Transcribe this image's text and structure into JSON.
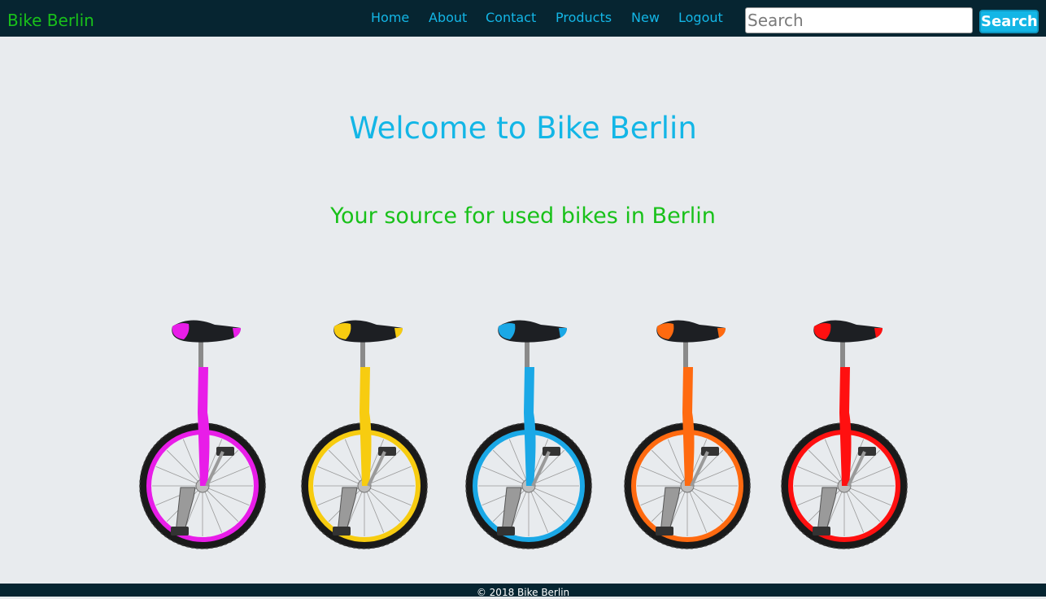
{
  "brand": {
    "name": "Bike Berlin",
    "color": "#19c11a"
  },
  "nav": {
    "links": [
      {
        "label": "Home"
      },
      {
        "label": "About"
      },
      {
        "label": "Contact"
      },
      {
        "label": "Products"
      },
      {
        "label": "New"
      },
      {
        "label": "Logout"
      }
    ],
    "link_color": "#13b6e6",
    "background": "#062531"
  },
  "search": {
    "placeholder": "Search",
    "value": "",
    "button_label": "Search"
  },
  "hero": {
    "title": "Welcome to Bike Berlin",
    "subtitle": "Your source for used bikes in Berlin"
  },
  "gallery": {
    "items": [
      {
        "name": "magenta unicycle",
        "color": "#e81de8",
        "icon": "unicycle-icon"
      },
      {
        "name": "yellow unicycle",
        "color": "#f7cc10",
        "icon": "unicycle-icon"
      },
      {
        "name": "blue unicycle",
        "color": "#1aa8e6",
        "icon": "unicycle-icon"
      },
      {
        "name": "orange unicycle",
        "color": "#ff6a10",
        "icon": "unicycle-icon"
      },
      {
        "name": "red unicycle",
        "color": "#ff1010",
        "icon": "unicycle-icon"
      }
    ]
  },
  "footer": {
    "copyright": "© 2018 Bike Berlin"
  }
}
